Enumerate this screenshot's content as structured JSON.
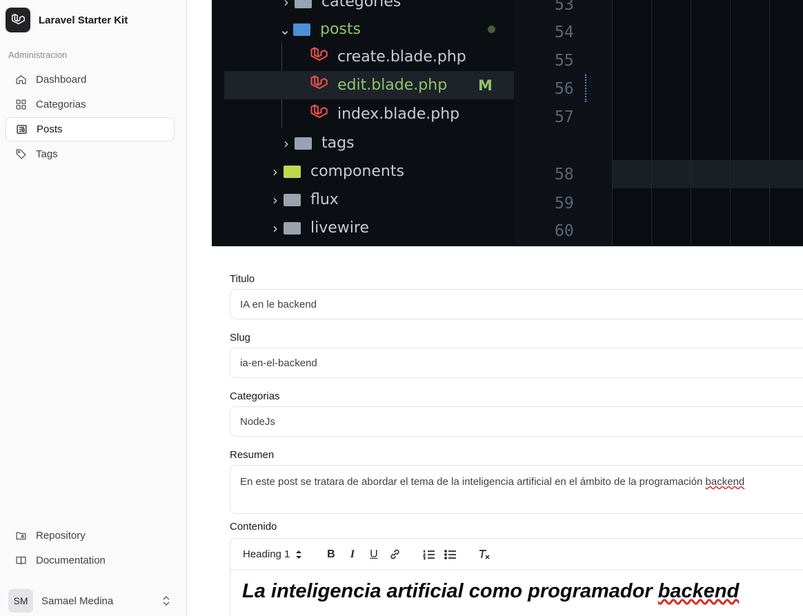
{
  "app": {
    "name": "Laravel Starter Kit"
  },
  "sidebar": {
    "section_heading": "Administracion",
    "items": [
      {
        "label": "Dashboard",
        "icon": "home-icon",
        "active": false
      },
      {
        "label": "Categorias",
        "icon": "grid-icon",
        "active": false
      },
      {
        "label": "Posts",
        "icon": "newspaper-icon",
        "active": true
      },
      {
        "label": "Tags",
        "icon": "tag-icon",
        "active": false
      }
    ],
    "bottom_items": [
      {
        "label": "Repository",
        "icon": "folder-git-icon"
      },
      {
        "label": "Documentation",
        "icon": "book-icon"
      }
    ],
    "user": {
      "initials": "SM",
      "name": "Samael Medina"
    }
  },
  "screenshot": {
    "tree": [
      {
        "label": "categories",
        "kind": "folder"
      },
      {
        "label": "posts",
        "kind": "folder-open"
      },
      {
        "label": "create.blade.php",
        "kind": "file"
      },
      {
        "label": "edit.blade.php",
        "kind": "file",
        "badge": "M"
      },
      {
        "label": "index.blade.php",
        "kind": "file"
      },
      {
        "label": "tags",
        "kind": "folder"
      },
      {
        "label": "components",
        "kind": "folder-components"
      },
      {
        "label": "flux",
        "kind": "folder"
      },
      {
        "label": "livewire",
        "kind": "folder"
      }
    ],
    "line_numbers": [
      "53",
      "54",
      "55",
      "56",
      "57",
      "58",
      "59",
      "60"
    ]
  },
  "form": {
    "titulo": {
      "label": "Titulo",
      "value": "IA en le backend"
    },
    "slug": {
      "label": "Slug",
      "value": "ia-en-el-backend"
    },
    "categorias": {
      "label": "Categorias",
      "value": "NodeJs"
    },
    "resumen": {
      "label": "Resumen",
      "value_prefix": "En este post se tratara de abordar el tema de la inteligencia artificial en el ámbito de la programación ",
      "value_flagged": "backend"
    },
    "contenido": {
      "label": "Contenido",
      "heading_select": "Heading 1",
      "heading_prefix": "La inteligencia artificial como programador ",
      "heading_flagged": "backend"
    }
  },
  "colors": {
    "accent_green": "#8fc36a",
    "laravel_red": "#e8504a",
    "spell_error": "#e02424"
  }
}
